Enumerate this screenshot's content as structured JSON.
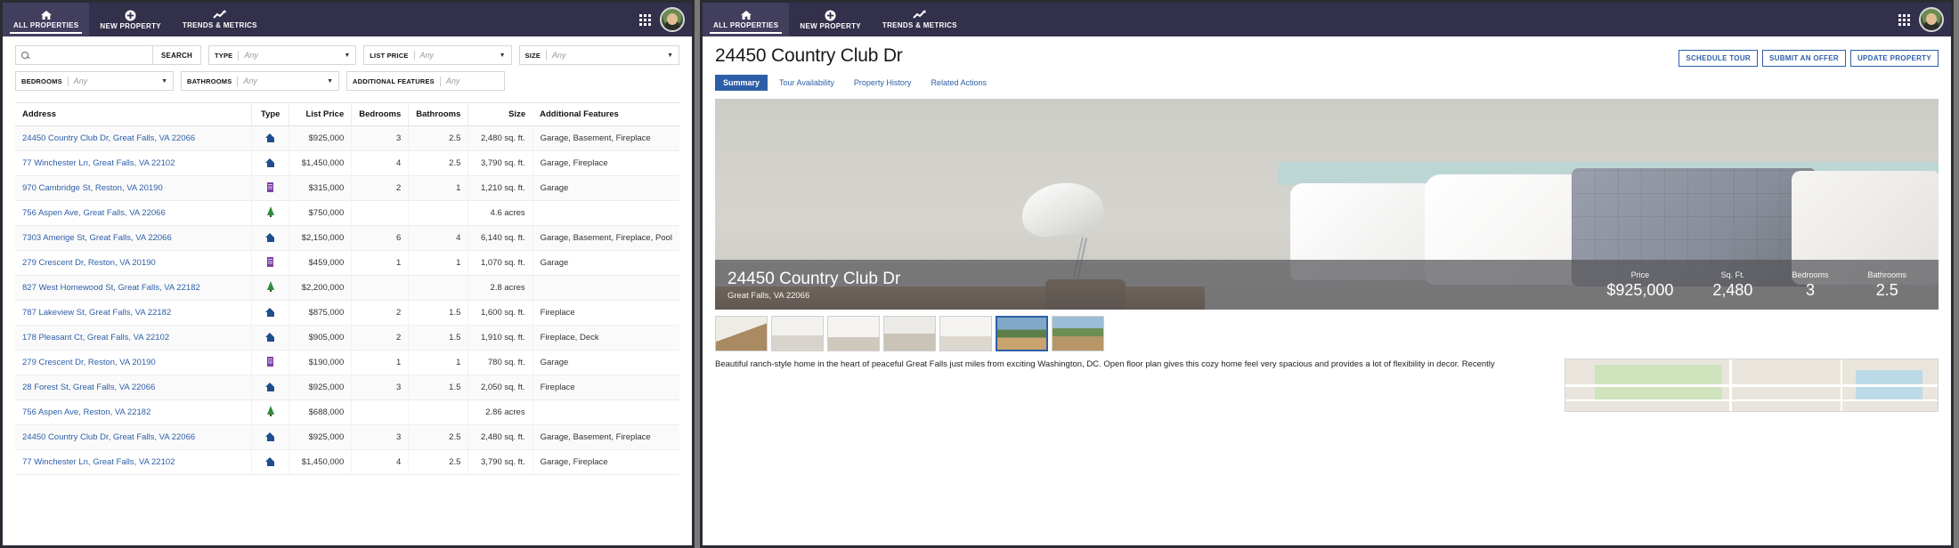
{
  "nav": {
    "tabs": [
      {
        "label": "ALL PROPERTIES",
        "icon": "home-icon",
        "active": true
      },
      {
        "label": "NEW PROPERTY",
        "icon": "plus-circle-icon",
        "active": false
      },
      {
        "label": "TRENDS & METRICS",
        "icon": "chart-line-icon",
        "active": false
      }
    ],
    "grid_icon": "grid-apps-icon",
    "avatar": "user-avatar"
  },
  "filters": {
    "search_placeholder": "",
    "search_value": "",
    "search_button": "SEARCH",
    "fields": [
      {
        "label": "TYPE",
        "value": "Any"
      },
      {
        "label": "LIST PRICE",
        "value": "Any"
      },
      {
        "label": "SIZE",
        "value": "Any"
      },
      {
        "label": "BEDROOMS",
        "value": "Any"
      },
      {
        "label": "BATHROOMS",
        "value": "Any"
      },
      {
        "label": "ADDITIONAL FEATURES",
        "value": "Any"
      }
    ]
  },
  "table": {
    "columns": [
      "Address",
      "Type",
      "List Price",
      "Bedrooms",
      "Bathrooms",
      "Size",
      "Additional Features"
    ],
    "rows": [
      {
        "address": "24450 Country Club Dr, Great Falls, VA 22066",
        "type": "house",
        "price": "$925,000",
        "bedrooms": "3",
        "bathrooms": "2.5",
        "size": "2,480 sq. ft.",
        "features": "Garage, Basement, Fireplace"
      },
      {
        "address": "77 Winchester Ln, Great Falls, VA 22102",
        "type": "house",
        "price": "$1,450,000",
        "bedrooms": "4",
        "bathrooms": "2.5",
        "size": "3,790 sq. ft.",
        "features": "Garage, Fireplace"
      },
      {
        "address": "970 Cambridge St, Reston, VA 20190",
        "type": "building",
        "price": "$315,000",
        "bedrooms": "2",
        "bathrooms": "1",
        "size": "1,210 sq. ft.",
        "features": "Garage"
      },
      {
        "address": "756 Aspen Ave, Great Falls, VA 22066",
        "type": "land",
        "price": "$750,000",
        "bedrooms": "",
        "bathrooms": "",
        "size": "4.6 acres",
        "features": ""
      },
      {
        "address": "7303 Amerige St, Great Falls, VA 22066",
        "type": "house",
        "price": "$2,150,000",
        "bedrooms": "6",
        "bathrooms": "4",
        "size": "6,140 sq. ft.",
        "features": "Garage, Basement, Fireplace, Pool"
      },
      {
        "address": "279 Crescent Dr, Reston, VA 20190",
        "type": "building",
        "price": "$459,000",
        "bedrooms": "1",
        "bathrooms": "1",
        "size": "1,070 sq. ft.",
        "features": "Garage"
      },
      {
        "address": "827 West Homewood St, Great Falls, VA 22182",
        "type": "land",
        "price": "$2,200,000",
        "bedrooms": "",
        "bathrooms": "",
        "size": "2.8 acres",
        "features": ""
      },
      {
        "address": "787 Lakeview St, Great Falls, VA 22182",
        "type": "house",
        "price": "$875,000",
        "bedrooms": "2",
        "bathrooms": "1.5",
        "size": "1,600 sq. ft.",
        "features": "Fireplace"
      },
      {
        "address": "178 Pleasant Ct, Great Falls, VA 22102",
        "type": "house",
        "price": "$905,000",
        "bedrooms": "2",
        "bathrooms": "1.5",
        "size": "1,910 sq. ft.",
        "features": "Fireplace, Deck"
      },
      {
        "address": "279 Crescent Dr, Reston, VA 20190",
        "type": "building",
        "price": "$190,000",
        "bedrooms": "1",
        "bathrooms": "1",
        "size": "780 sq. ft.",
        "features": "Garage"
      },
      {
        "address": "28 Forest St, Great Falls, VA 22066",
        "type": "house",
        "price": "$925,000",
        "bedrooms": "3",
        "bathrooms": "1.5",
        "size": "2,050 sq. ft.",
        "features": "Fireplace"
      },
      {
        "address": "756 Aspen Ave, Reston, VA 22182",
        "type": "land",
        "price": "$688,000",
        "bedrooms": "",
        "bathrooms": "",
        "size": "2.86 acres",
        "features": ""
      },
      {
        "address": "24450 Country Club Dr, Great Falls, VA 22066",
        "type": "house",
        "price": "$925,000",
        "bedrooms": "3",
        "bathrooms": "2.5",
        "size": "2,480 sq. ft.",
        "features": "Garage, Basement, Fireplace"
      },
      {
        "address": "77 Winchester Ln, Great Falls, VA 22102",
        "type": "house",
        "price": "$1,450,000",
        "bedrooms": "4",
        "bathrooms": "2.5",
        "size": "3,790 sq. ft.",
        "features": "Garage, Fireplace"
      }
    ]
  },
  "detail": {
    "title": "24450 Country Club Dr",
    "actions": [
      {
        "label": "SCHEDULE TOUR"
      },
      {
        "label": "SUBMIT AN OFFER"
      },
      {
        "label": "UPDATE PROPERTY"
      }
    ],
    "tabs": [
      {
        "label": "Summary",
        "active": true
      },
      {
        "label": "Tour Availability",
        "active": false
      },
      {
        "label": "Property History",
        "active": false
      },
      {
        "label": "Related Actions",
        "active": false
      }
    ],
    "hero": {
      "address_line1": "24450 Country Club Dr",
      "address_line2": "Great Falls, VA 22066",
      "stats": [
        {
          "key": "Price",
          "value": "$925,000"
        },
        {
          "key": "Sq. Ft.",
          "value": "2,480"
        },
        {
          "key": "Bedrooms",
          "value": "3"
        },
        {
          "key": "Bathrooms",
          "value": "2.5"
        }
      ]
    },
    "thumbnails": [
      {
        "name": "thumb-bedroom-desk",
        "cls": "t1",
        "selected": false
      },
      {
        "name": "thumb-kitchen",
        "cls": "t2",
        "selected": false
      },
      {
        "name": "thumb-living-room",
        "cls": "t3",
        "selected": false
      },
      {
        "name": "thumb-dining",
        "cls": "t4",
        "selected": false
      },
      {
        "name": "thumb-bathroom",
        "cls": "t5",
        "selected": false
      },
      {
        "name": "thumb-exterior-front",
        "cls": "t6",
        "selected": true
      },
      {
        "name": "thumb-exterior-yard",
        "cls": "t7",
        "selected": false
      }
    ],
    "description": "Beautiful ranch-style home in the heart of peaceful Great Falls just miles from exciting Washington, DC. Open floor plan gives this cozy home feel very spacious and provides a lot of flexibility in decor. Recently"
  },
  "colors": {
    "navbar": "#32304a",
    "nav_active": "#423e5e",
    "link": "#2d5fa8",
    "accent": "#2d5fa8",
    "house_icon": "#1f4e8c",
    "building_icon": "#7b3fa8",
    "land_icon": "#2e8b3d"
  }
}
